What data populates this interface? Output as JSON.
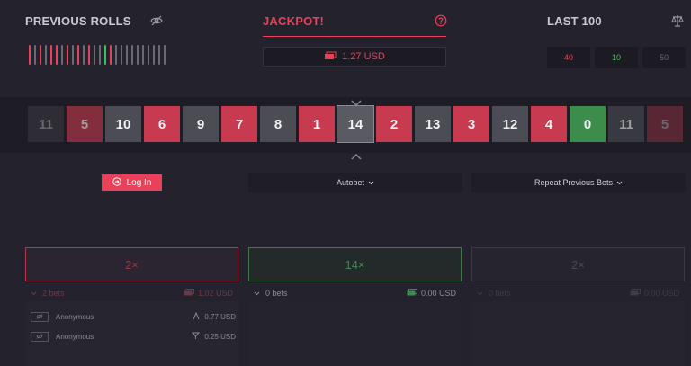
{
  "header": {
    "previous_rolls": "PREVIOUS ROLLS",
    "jackpot": "JACKPOT!",
    "last_100": "LAST 100"
  },
  "jackpot_amount": "1.27 USD",
  "last100": [
    {
      "label": "40",
      "color": "#e8425b"
    },
    {
      "label": "10",
      "color": "#3fbf5a"
    },
    {
      "label": "50",
      "color": "#6a6a74"
    }
  ],
  "previous_rolls": [
    "red",
    "gray",
    "red",
    "gray",
    "red",
    "red",
    "gray",
    "red",
    "gray",
    "red",
    "gray",
    "red",
    "gray",
    "gray",
    "green",
    "red",
    "gray",
    "gray",
    "gray",
    "gray",
    "gray",
    "gray",
    "gray",
    "gray",
    "gray",
    "gray"
  ],
  "roll_strip": [
    {
      "value": "11",
      "color": "gray",
      "state": "fade"
    },
    {
      "value": "5",
      "color": "red",
      "state": "fade2"
    },
    {
      "value": "10",
      "color": "gray",
      "state": ""
    },
    {
      "value": "6",
      "color": "red",
      "state": ""
    },
    {
      "value": "9",
      "color": "gray",
      "state": ""
    },
    {
      "value": "7",
      "color": "red",
      "state": ""
    },
    {
      "value": "8",
      "color": "gray",
      "state": ""
    },
    {
      "value": "1",
      "color": "red",
      "state": ""
    },
    {
      "value": "14",
      "color": "gray",
      "state": "active"
    },
    {
      "value": "2",
      "color": "red",
      "state": ""
    },
    {
      "value": "13",
      "color": "gray",
      "state": ""
    },
    {
      "value": "3",
      "color": "red",
      "state": ""
    },
    {
      "value": "12",
      "color": "gray",
      "state": ""
    },
    {
      "value": "4",
      "color": "red",
      "state": ""
    },
    {
      "value": "0",
      "color": "green",
      "state": ""
    },
    {
      "value": "11",
      "color": "gray",
      "state": "fade2"
    },
    {
      "value": "5",
      "color": "red",
      "state": "fade"
    }
  ],
  "controls": {
    "login": "Log In",
    "autobet": "Autobet",
    "repeat": "Repeat Previous Bets"
  },
  "bets": {
    "red": {
      "multiplier": "2×",
      "count": "2 bets",
      "total": "1.02 USD"
    },
    "green": {
      "multiplier": "14×",
      "count": "0 bets",
      "total": "0.00 USD"
    },
    "gray": {
      "multiplier": "2×",
      "count": "0 bets",
      "total": "0.00 USD"
    }
  },
  "bettors": [
    {
      "name": "Anonymous",
      "amount": "0.77 USD"
    },
    {
      "name": "Anonymous",
      "amount": "0.25 USD"
    }
  ]
}
